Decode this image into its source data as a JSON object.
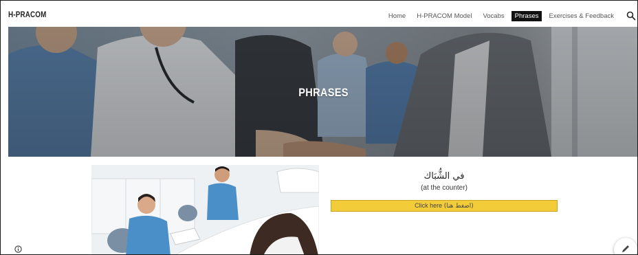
{
  "header": {
    "brand": "H-PRACOM",
    "nav": [
      {
        "label": "Home",
        "active": false
      },
      {
        "label": "H-PRACOM Model",
        "active": false
      },
      {
        "label": "Vocabs",
        "active": false
      },
      {
        "label": "Phrases",
        "active": true
      },
      {
        "label": "Exercises & Feedback",
        "active": false
      }
    ],
    "search_icon": "search-icon"
  },
  "hero": {
    "title": "PHRASES"
  },
  "phrase": {
    "arabic": "في الشُّبَاك",
    "english": "(at the counter)",
    "cta_label": "Click here",
    "cta_arabic": "(اضغط هنا)"
  },
  "colors": {
    "cta_background": "#f3cc3a",
    "active_nav": "#111111"
  },
  "icons": {
    "info": "info-icon",
    "edit": "pencil-icon"
  }
}
